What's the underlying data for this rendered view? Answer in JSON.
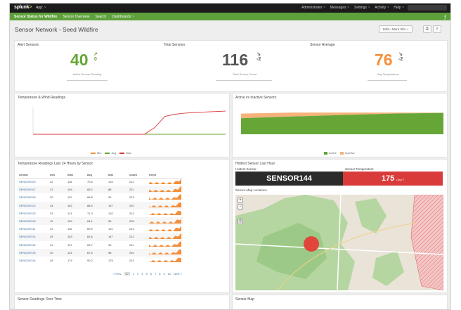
{
  "topbar": {
    "logo_prefix": "splunk",
    "logo_suffix": ">",
    "app_dropdown": "App: ~",
    "menu": [
      "Administrator ~",
      "Messages ~",
      "Settings ~",
      "Activity ~",
      "Help ~"
    ]
  },
  "appbar": {
    "nav": [
      "Sensor Status for Wildfire",
      "Sensor Overview",
      "Search",
      "Dashboards ~"
    ],
    "icon": "fire-icon"
  },
  "page": {
    "title": "Sensor Network - Seed Wildfire",
    "edit_label": "Edit ~  More Info ~",
    "print_label": "⎙",
    "export_label": "⇩"
  },
  "singles": [
    {
      "label": "Alert Sensors",
      "value": "40",
      "delta": "↗",
      "delta2": "0",
      "caption": "Active Sensor Reading",
      "color": "#65a637"
    },
    {
      "label": "Total Sensors",
      "value": "116",
      "delta": "↘",
      "delta2": "-2",
      "caption": "Total Sensor Count",
      "color": "#555555"
    },
    {
      "label": "Sensor Average",
      "value": "76",
      "delta": "↘",
      "delta2": "-2",
      "caption": "Avg Temperature",
      "color": "#f58f39"
    }
  ],
  "line_panel": {
    "title": "Temperature & Wind Readings",
    "legend": [
      "Min",
      "Avg",
      "Max"
    ],
    "legend_colors": [
      "#f58f39",
      "#65a637",
      "#d93a3a"
    ]
  },
  "area_panel": {
    "title": "Active vs Inactive Sensors",
    "legend": [
      "Active",
      "Inactive"
    ],
    "legend_colors": [
      "#65a637",
      "#f5b27a"
    ]
  },
  "table_panel": {
    "title": "Temperature Readings Last 24 Hours by Sensor",
    "columns": [
      "sensor",
      "min",
      "max",
      "avg",
      "last",
      "count",
      "trend"
    ],
    "rows": [
      {
        "sensor": "SENSOR103",
        "min": "22",
        "max": "118",
        "avg": "70.6",
        "last": "104",
        "count": "212"
      },
      {
        "sensor": "SENSOR107",
        "min": "21",
        "max": "104",
        "avg": "65.2",
        "last": "88",
        "count": "211"
      },
      {
        "sensor": "SENSOR108",
        "min": "20",
        "max": "112",
        "avg": "66.8",
        "last": "92",
        "count": "213"
      },
      {
        "sensor": "SENSOR120",
        "min": "24",
        "max": "162",
        "avg": "88.4",
        "last": "157",
        "count": "210"
      },
      {
        "sensor": "SENSOR125",
        "min": "23",
        "max": "121",
        "avg": "71.3",
        "last": "102",
        "count": "212"
      },
      {
        "sensor": "SENSOR128",
        "min": "19",
        "max": "109",
        "avg": "64.1",
        "last": "95",
        "count": "209"
      },
      {
        "sensor": "SENSOR131",
        "min": "22",
        "max": "116",
        "avg": "69.9",
        "last": "101",
        "count": "213"
      },
      {
        "sensor": "SENSOR132",
        "min": "25",
        "max": "153",
        "avg": "81.6",
        "last": "147",
        "count": "212"
      },
      {
        "sensor": "SENSOR136",
        "min": "21",
        "max": "107",
        "avg": "63.7",
        "last": "90",
        "count": "211"
      },
      {
        "sensor": "SENSOR139",
        "min": "20",
        "max": "113",
        "avg": "67.5",
        "last": "98",
        "count": "210"
      },
      {
        "sensor": "SENSOR144",
        "min": "26",
        "max": "175",
        "avg": "90.2",
        "last": "175",
        "count": "212"
      }
    ],
    "pager": [
      "« Prev",
      "1",
      "2",
      "3",
      "4",
      "5",
      "6",
      "7",
      "8",
      "9",
      "10",
      "Next »"
    ]
  },
  "hottest_panel": {
    "title": "Hottest Sensor Last Hour",
    "sensor_label": "Hottest Sensor",
    "sensor_value": "SENSOR144",
    "temp_label": "Sensor Temperature",
    "temp_value": "175",
    "temp_unit": "Deg F",
    "map_label": "Sensor Map Locations"
  },
  "bottom": {
    "left_title": "Sensor Readings Over Time",
    "right_title": "Sensor Map"
  },
  "chart_data": [
    {
      "type": "line",
      "title": "Temperature & Wind Readings",
      "series": [
        {
          "name": "Min",
          "values": [
            0,
            0,
            0,
            0,
            0,
            0,
            0,
            0,
            0,
            0,
            0,
            0,
            0,
            0,
            0,
            0,
            0,
            0,
            0,
            0
          ]
        },
        {
          "name": "Avg",
          "values": [
            0,
            0,
            0,
            0,
            0,
            0,
            0,
            0,
            0,
            0,
            0,
            0,
            0,
            0,
            0,
            0,
            0,
            0,
            0,
            0
          ]
        },
        {
          "name": "Max",
          "values": [
            0,
            0,
            0,
            0,
            0,
            0,
            0,
            0,
            0,
            0,
            0,
            0,
            30,
            80,
            90,
            95,
            98,
            100,
            102,
            104
          ]
        }
      ]
    },
    {
      "type": "area",
      "title": "Active vs Inactive Sensors",
      "series": [
        {
          "name": "Active",
          "values": [
            90,
            95,
            100,
            104,
            108,
            112,
            116,
            118,
            120
          ]
        },
        {
          "name": "Inactive",
          "values": [
            26,
            24,
            22,
            18,
            14,
            10,
            6,
            3,
            1
          ]
        }
      ]
    }
  ]
}
